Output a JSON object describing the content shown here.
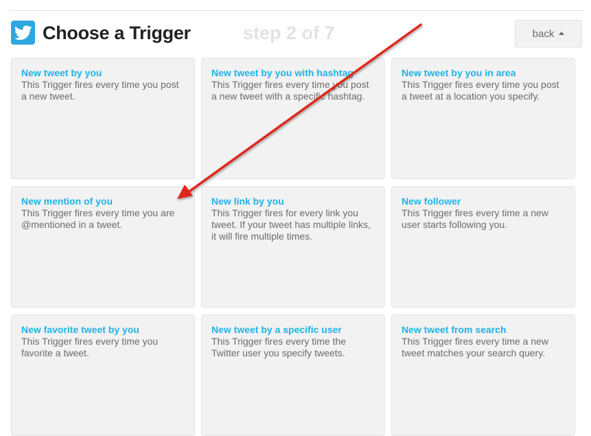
{
  "header": {
    "title": "Choose a Trigger",
    "step": "step 2 of 7",
    "back_label": "back",
    "logo_icon": "twitter-bird-icon",
    "logo_color": "#2ea7e0"
  },
  "triggers": [
    {
      "title": "New tweet by you",
      "description": "This Trigger fires every time you post a new tweet."
    },
    {
      "title": "New tweet by you with hashtag",
      "description": "This Trigger fires every time you post a new tweet with a specific hashtag."
    },
    {
      "title": "New tweet by you in area",
      "description": "This Trigger fires every time you post a tweet at a location you specify."
    },
    {
      "title": "New mention of you",
      "description": "This Trigger fires every time you are @mentioned in a tweet."
    },
    {
      "title": "New link by you",
      "description": "This Trigger fires for every link you tweet. If your tweet has multiple links, it will fire multiple times."
    },
    {
      "title": "New follower",
      "description": "This Trigger fires every time a new user starts following you."
    },
    {
      "title": "New favorite tweet by you",
      "description": "This Trigger fires every time you favorite a tweet."
    },
    {
      "title": "New tweet by a specific user",
      "description": "This Trigger fires every time the Twitter user you specify tweets."
    },
    {
      "title": "New tweet from search",
      "description": "This Trigger fires every time a new tweet matches your search query."
    }
  ],
  "colors": {
    "card_title": "#1fb2e6",
    "annotation_arrow": "#e0261b"
  }
}
